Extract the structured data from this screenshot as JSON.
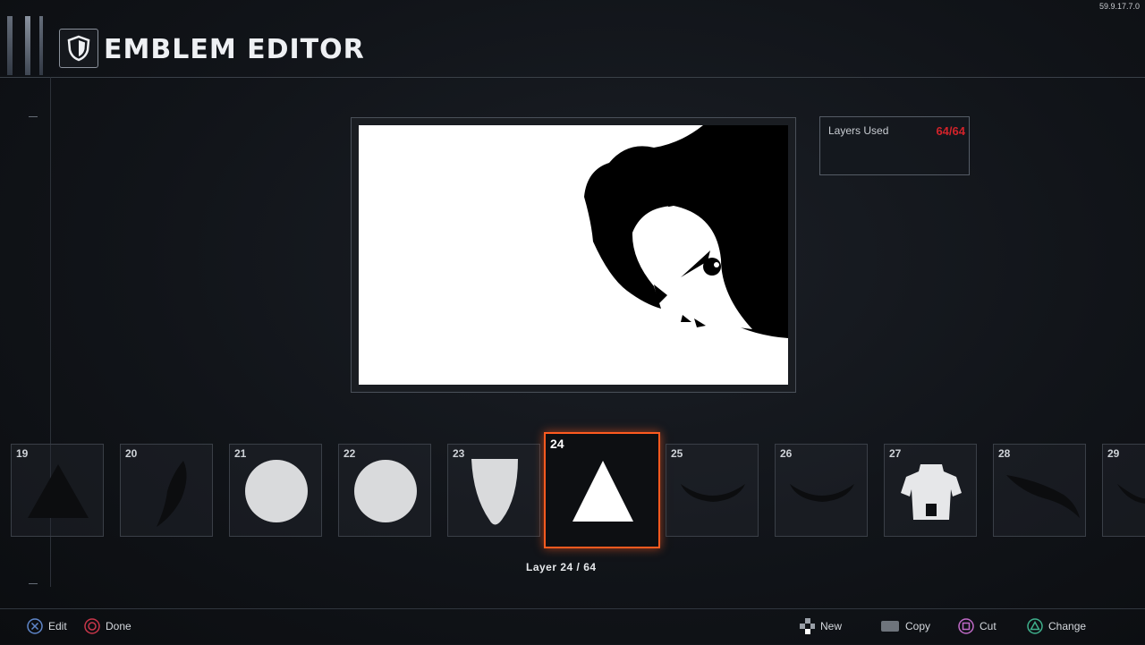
{
  "version": "59.9.17.7.0",
  "header": {
    "title": "EMBLEM EDITOR"
  },
  "layers_panel": {
    "label": "Layers Used",
    "count": "64/64"
  },
  "strip": {
    "tiles": [
      {
        "num": "19",
        "shape": "triangle-dark"
      },
      {
        "num": "20",
        "shape": "leaf-dark"
      },
      {
        "num": "21",
        "shape": "circle-light"
      },
      {
        "num": "22",
        "shape": "circle-light"
      },
      {
        "num": "23",
        "shape": "shield-light"
      },
      {
        "num": "24",
        "shape": "triangle-white",
        "selected": true
      },
      {
        "num": "25",
        "shape": "arc-dark"
      },
      {
        "num": "26",
        "shape": "arc-dark"
      },
      {
        "num": "27",
        "shape": "armor-light"
      },
      {
        "num": "28",
        "shape": "swoosh-dark"
      },
      {
        "num": "29",
        "shape": "arc-dark"
      }
    ],
    "selected_label": "Layer 24 / 64"
  },
  "controls": {
    "edit": "Edit",
    "done": "Done",
    "new": "New",
    "copy": "Copy",
    "cut": "Cut",
    "change": "Change"
  },
  "colors": {
    "accent": "#ff5a1f",
    "layers_full": "#d2232a"
  }
}
